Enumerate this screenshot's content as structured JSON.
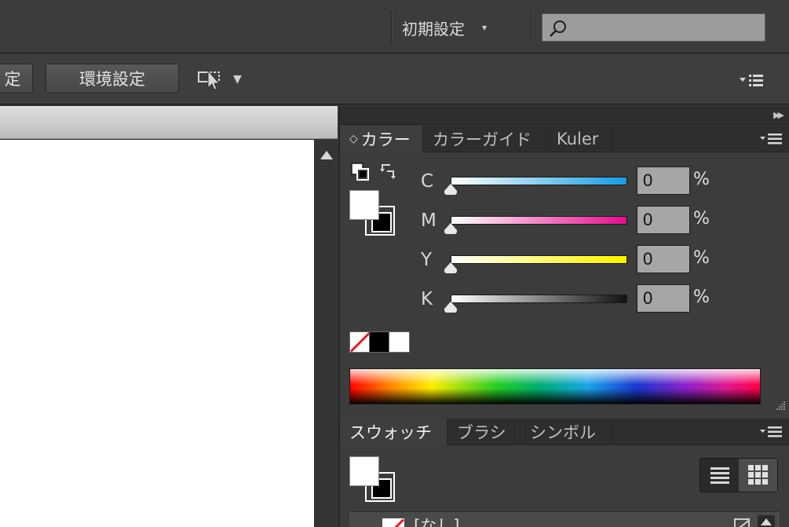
{
  "topbar": {
    "workspace_label": "初期設定",
    "workspace_caret": "▾",
    "search_placeholder": ""
  },
  "controlbar": {
    "left_button_label": "定",
    "preferences_label": "環境設定",
    "arrange_caret": "▼"
  },
  "color_panel": {
    "tabs": [
      {
        "label": "カラー",
        "active": true,
        "prefix": "◇"
      },
      {
        "label": "カラーガイド",
        "active": false
      },
      {
        "label": "Kuler",
        "active": false
      }
    ],
    "channels": [
      {
        "letter": "C",
        "value": "0",
        "unit": "%",
        "color": "#1a9be0"
      },
      {
        "letter": "M",
        "value": "0",
        "unit": "%",
        "color": "#e0108c"
      },
      {
        "letter": "Y",
        "value": "0",
        "unit": "%",
        "color": "#fff200"
      },
      {
        "letter": "K",
        "value": "0",
        "unit": "%",
        "color": "#111111"
      }
    ]
  },
  "swatches_panel": {
    "tabs": [
      {
        "label": "スウォッチ",
        "active": true
      },
      {
        "label": "ブラシ",
        "active": false
      },
      {
        "label": "シンボル",
        "active": false
      }
    ],
    "rows": [
      {
        "name": "[なし]"
      }
    ]
  },
  "colors": {
    "app_bg": "#3c3c3c",
    "panel_bg": "#3c3c3c",
    "tab_bar_bg": "#2e2e2e",
    "field_bg": "#a6a6a6",
    "none_slash": "#e02020"
  }
}
